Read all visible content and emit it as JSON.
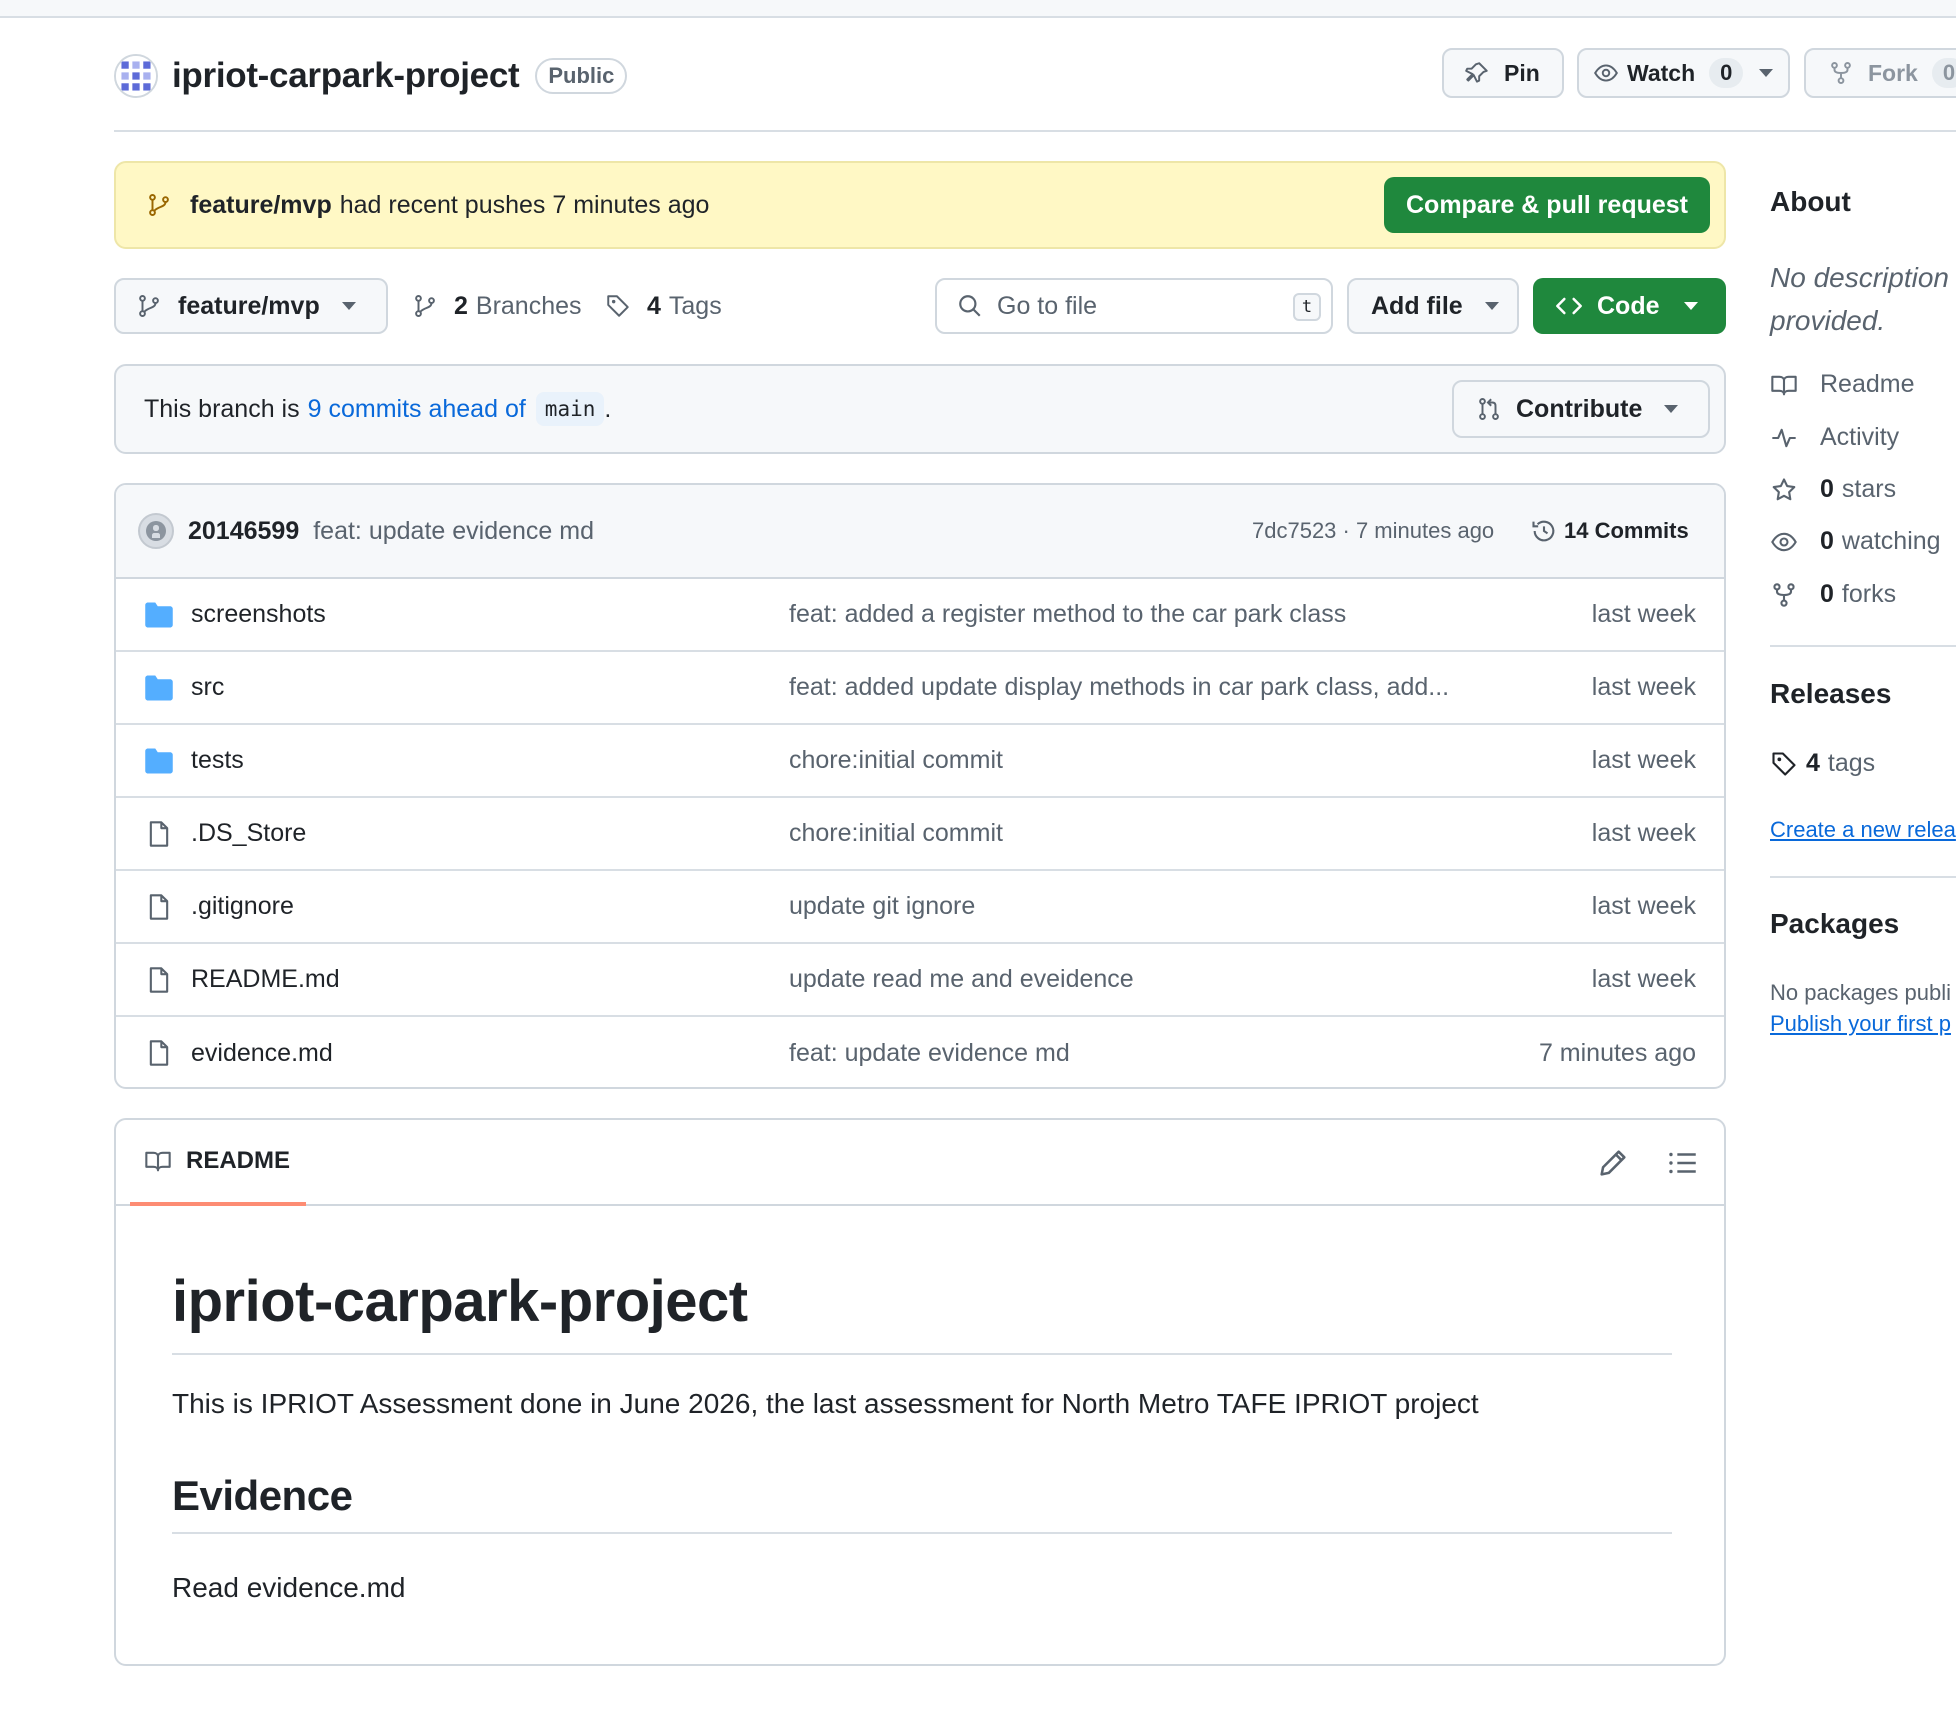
{
  "repo": {
    "name": "ipriot-carpark-project",
    "visibility": "Public"
  },
  "header_actions": {
    "pin": "Pin",
    "watch": "Watch",
    "watch_count": "0",
    "fork": "Fork",
    "fork_count": "0"
  },
  "push_banner": {
    "branch": "feature/mvp",
    "text": "had recent pushes 7 minutes ago",
    "button": "Compare & pull request"
  },
  "toolbar": {
    "branch": "feature/mvp",
    "branches_count": "2",
    "branches_label": "Branches",
    "tags_count": "4",
    "tags_label": "Tags",
    "search_placeholder": "Go to file",
    "search_key": "t",
    "add_file": "Add file",
    "code": "Code"
  },
  "ahead": {
    "prefix": "This branch is",
    "link": "9 commits ahead of",
    "base": "main",
    "suffix": ".",
    "contribute": "Contribute"
  },
  "latest_commit": {
    "author": "20146599",
    "message": "feat: update evidence md",
    "meta": "7dc7523 · 7 minutes ago",
    "commits": "14 Commits"
  },
  "files": [
    {
      "type": "folder",
      "name": "screenshots",
      "message": "feat: added a register method to the car park class",
      "date": "last week"
    },
    {
      "type": "folder",
      "name": "src",
      "message": "feat: added update display methods in car park class, add...",
      "date": "last week"
    },
    {
      "type": "folder",
      "name": "tests",
      "message": "chore:initial commit",
      "date": "last week"
    },
    {
      "type": "file",
      "name": ".DS_Store",
      "message": "chore:initial commit",
      "date": "last week"
    },
    {
      "type": "file",
      "name": ".gitignore",
      "message": "update git ignore",
      "date": "last week"
    },
    {
      "type": "file",
      "name": "README.md",
      "message": "update read me and eveidence",
      "date": "last week"
    },
    {
      "type": "file",
      "name": "evidence.md",
      "message": "feat: update evidence md",
      "date": "7 minutes ago"
    }
  ],
  "readme": {
    "tab": "README",
    "title": "ipriot-carpark-project",
    "intro": "This is IPRIOT Assessment done in June 2026, the last assessment for North Metro TAFE IPRIOT project",
    "h2": "Evidence",
    "body": "Read evidence.md"
  },
  "sidebar": {
    "about_heading": "About",
    "description_line1": "No description",
    "description_line2": "provided.",
    "readme": "Readme",
    "activity": "Activity",
    "stars_count": "0",
    "stars_label": "stars",
    "watching_count": "0",
    "watching_label": "watching",
    "forks_count": "0",
    "forks_label": "forks",
    "releases_heading": "Releases",
    "tags_count": "4",
    "tags_label": "tags",
    "create_release": "Create a new relea",
    "packages_heading": "Packages",
    "no_packages": "No packages publi",
    "publish_first": "Publish your first p"
  },
  "colors": {
    "green": "#1f883d",
    "link": "#0969da",
    "banner_bg": "#fff8c5",
    "folder": "#54aeff",
    "tab_underline": "#fd8c73"
  }
}
